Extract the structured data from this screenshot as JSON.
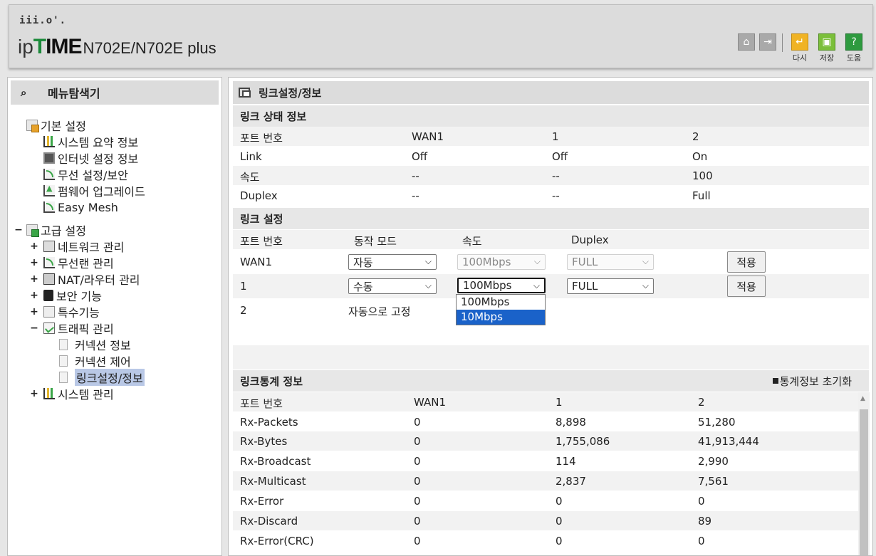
{
  "header": {
    "brand_dots": "iii.o'.",
    "brand_ip": "ip",
    "brand_time_t": "T",
    "brand_time_rest": "IME",
    "model": "N702E/N702E plus",
    "buttons": {
      "redo": "다시",
      "save": "저장",
      "help": "도움"
    }
  },
  "sidebar": {
    "title": "메뉴탐색기",
    "basic": {
      "label": "기본 설정",
      "items": [
        "시스템 요약 정보",
        "인터넷 설정 정보",
        "무선 설정/보안",
        "펌웨어 업그레이드",
        "Easy Mesh"
      ]
    },
    "advanced": {
      "label": "고급 설정",
      "toggle": "−",
      "items": [
        {
          "toggle": "+",
          "label": "네트워크 관리"
        },
        {
          "toggle": "+",
          "label": "무선랜 관리"
        },
        {
          "toggle": "+",
          "label": "NAT/라우터 관리"
        },
        {
          "toggle": "+",
          "label": "보안 기능"
        },
        {
          "toggle": "+",
          "label": "특수기능"
        },
        {
          "toggle": "−",
          "label": "트래픽 관리"
        },
        {
          "toggle": "+",
          "label": "시스템 관리"
        }
      ],
      "traffic_children": [
        "커넥션 정보",
        "커넥션 제어",
        "링크설정/정보"
      ]
    }
  },
  "main": {
    "title": "링크설정/정보",
    "link_status": {
      "title": "링크 상태 정보",
      "headers": [
        "포트 번호",
        "WAN1",
        "1",
        "2"
      ],
      "rows": [
        [
          "Link",
          "Off",
          "Off",
          "On"
        ],
        [
          "속도",
          "--",
          "--",
          "100"
        ],
        [
          "Duplex",
          "--",
          "--",
          "Full"
        ]
      ]
    },
    "link_setting": {
      "title": "링크 설정",
      "headers": [
        "포트 번호",
        "동작 모드",
        "속도",
        "Duplex"
      ],
      "rows": [
        {
          "port": "WAN1",
          "mode": "자동",
          "speed": "100Mbps",
          "duplex": "FULL",
          "apply": "적용"
        },
        {
          "port": "1",
          "mode": "수동",
          "speed": "100Mbps",
          "duplex": "FULL",
          "apply": "적용"
        },
        {
          "port": "2",
          "fixed": "자동으로 고정"
        }
      ],
      "speed_options": [
        "100Mbps",
        "10Mbps"
      ]
    },
    "link_stats": {
      "title": "링크통계 정보",
      "reset": "통계정보 초기화",
      "headers": [
        "포트 번호",
        "WAN1",
        "1",
        "2"
      ],
      "rows": [
        [
          "Rx-Packets",
          "0",
          "8,898",
          "51,280"
        ],
        [
          "Rx-Bytes",
          "0",
          "1,755,086",
          "41,913,444"
        ],
        [
          "Rx-Broadcast",
          "0",
          "114",
          "2,990"
        ],
        [
          "Rx-Multicast",
          "0",
          "2,837",
          "7,561"
        ],
        [
          "Rx-Error",
          "0",
          "0",
          "0"
        ],
        [
          "Rx-Discard",
          "0",
          "0",
          "89"
        ],
        [
          "Rx-Error(CRC)",
          "0",
          "0",
          "0"
        ]
      ]
    }
  }
}
